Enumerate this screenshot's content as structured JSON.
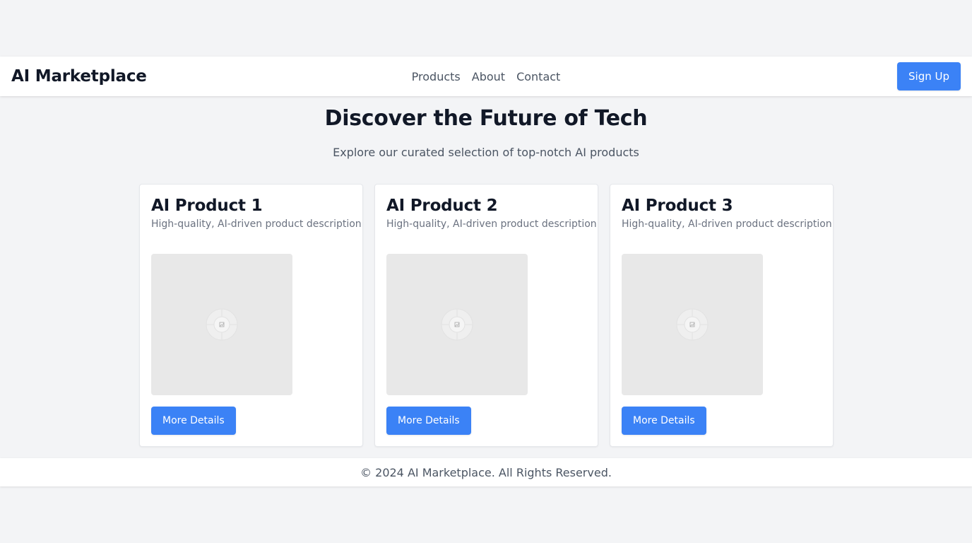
{
  "header": {
    "logo": "AI Marketplace",
    "nav": [
      {
        "label": "Products"
      },
      {
        "label": "About"
      },
      {
        "label": "Contact"
      }
    ],
    "signup_label": "Sign Up"
  },
  "hero": {
    "title": "Discover the Future of Tech",
    "subtitle": "Explore our curated selection of top-notch AI products"
  },
  "products": [
    {
      "title": "AI Product 1",
      "description": "High-quality, AI-driven product description",
      "image_icon": "image-placeholder-icon",
      "button_label": "More Details"
    },
    {
      "title": "AI Product 2",
      "description": "High-quality, AI-driven product description",
      "image_icon": "image-placeholder-icon",
      "button_label": "More Details"
    },
    {
      "title": "AI Product 3",
      "description": "High-quality, AI-driven product description",
      "image_icon": "image-placeholder-icon",
      "button_label": "More Details"
    }
  ],
  "footer": {
    "text": "© 2024 AI Marketplace. All Rights Reserved."
  },
  "colors": {
    "accent": "#3b82f6",
    "background": "#f3f4f6",
    "surface": "#ffffff",
    "text_primary": "#111827",
    "text_secondary": "#4b5563",
    "image_placeholder": "#e8e8e8"
  }
}
